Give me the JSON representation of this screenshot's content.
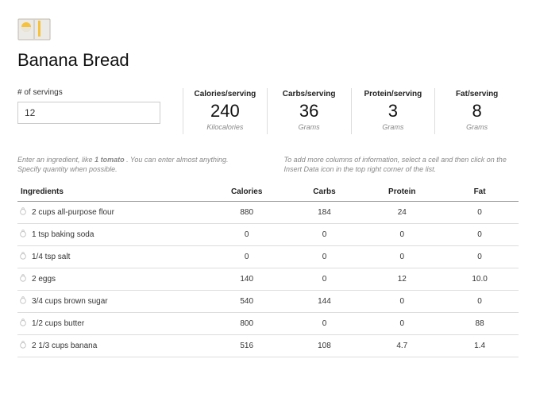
{
  "title": "Banana Bread",
  "servings": {
    "label": "# of servings",
    "value": "12"
  },
  "stats": [
    {
      "label": "Calories/serving",
      "value": "240",
      "unit": "Kilocalories"
    },
    {
      "label": "Carbs/serving",
      "value": "36",
      "unit": "Grams"
    },
    {
      "label": "Protein/serving",
      "value": "3",
      "unit": "Grams"
    },
    {
      "label": "Fat/serving",
      "value": "8",
      "unit": "Grams"
    }
  ],
  "hints": {
    "left_pre": "Enter an ingredient, like ",
    "left_bold": "1 tomato",
    "left_post": " . You can enter almost anything. Specify quantity when possible.",
    "right": "To add more columns of information, select a cell and then click on the Insert Data icon in the top right corner of the list."
  },
  "table": {
    "headers": [
      "Ingredients",
      "Calories",
      "Carbs",
      "Protein",
      "Fat"
    ],
    "rows": [
      {
        "name": "2 cups all-purpose flour",
        "calories": "880",
        "carbs": "184",
        "protein": "24",
        "fat": "0"
      },
      {
        "name": "1 tsp baking soda",
        "calories": "0",
        "carbs": "0",
        "protein": "0",
        "fat": "0"
      },
      {
        "name": "1/4 tsp salt",
        "calories": "0",
        "carbs": "0",
        "protein": "0",
        "fat": "0"
      },
      {
        "name": "2 eggs",
        "calories": "140",
        "carbs": "0",
        "protein": "12",
        "fat": "10.0"
      },
      {
        "name": "3/4 cups brown sugar",
        "calories": "540",
        "carbs": "144",
        "protein": "0",
        "fat": "0"
      },
      {
        "name": "1/2 cups butter",
        "calories": "800",
        "carbs": "0",
        "protein": "0",
        "fat": "88"
      },
      {
        "name": "2 1/3 cups banana",
        "calories": "516",
        "carbs": "108",
        "protein": "4.7",
        "fat": "1.4"
      }
    ]
  }
}
